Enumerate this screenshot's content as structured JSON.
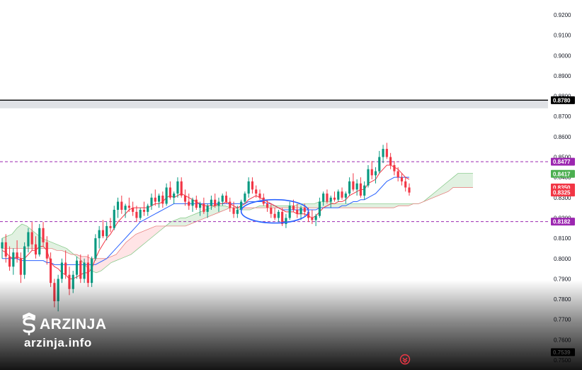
{
  "watermark": {
    "name": "ARZINJA",
    "site": "arzinja.info"
  },
  "chart_data": {
    "type": "candlestick",
    "y_axis": {
      "range": [
        0.75,
        0.925
      ],
      "ticks": [
        "0.9200",
        "0.9100",
        "0.9000",
        "0.8900",
        "0.8800",
        "0.8700",
        "0.8600",
        "0.8500",
        "0.8400",
        "0.8300",
        "0.8200",
        "0.8100",
        "0.8000",
        "0.7900",
        "0.7800",
        "0.7700",
        "0.7600",
        "0.7539",
        "0.7500"
      ]
    },
    "horizontal_line": {
      "value": 0.878,
      "label": "0.8780",
      "band": [
        0.874,
        0.878
      ],
      "color": "#000000"
    },
    "dashed_levels": [
      {
        "value": 0.8477,
        "label": "0.8477",
        "color": "#9c27b0"
      },
      {
        "value": 0.8182,
        "label": "0.8182",
        "color": "#9c27b0"
      }
    ],
    "price_tags": [
      {
        "value": 0.8417,
        "label": "0.8417",
        "color": "#4caf50"
      },
      {
        "value": 0.835,
        "label": "0.8350",
        "color": "#f23645"
      },
      {
        "value": 0.8325,
        "label": "0.8325",
        "color": "#f23645"
      },
      {
        "value": 0.7539,
        "label": "0.7539",
        "color": "#000000"
      }
    ],
    "colors": {
      "up": "#089981",
      "down": "#f23645",
      "tenkan": "#f23645",
      "kijun": "#2962ff",
      "cloud_up": "#c8e6c9",
      "cloud_down": "#ffcdd2",
      "ellipse": "#2962ff"
    },
    "candles": [
      [
        0.805,
        0.81,
        0.8,
        0.808
      ],
      [
        0.808,
        0.812,
        0.798,
        0.801
      ],
      [
        0.801,
        0.806,
        0.794,
        0.796
      ],
      [
        0.796,
        0.805,
        0.792,
        0.803
      ],
      [
        0.803,
        0.809,
        0.798,
        0.8
      ],
      [
        0.8,
        0.803,
        0.788,
        0.792
      ],
      [
        0.792,
        0.808,
        0.79,
        0.806
      ],
      [
        0.806,
        0.815,
        0.803,
        0.813
      ],
      [
        0.813,
        0.818,
        0.804,
        0.807
      ],
      [
        0.807,
        0.811,
        0.8,
        0.802
      ],
      [
        0.802,
        0.817,
        0.801,
        0.815
      ],
      [
        0.815,
        0.818,
        0.806,
        0.808
      ],
      [
        0.808,
        0.811,
        0.797,
        0.8
      ],
      [
        0.8,
        0.803,
        0.786,
        0.788
      ],
      [
        0.788,
        0.79,
        0.776,
        0.779
      ],
      [
        0.779,
        0.792,
        0.774,
        0.79
      ],
      [
        0.79,
        0.8,
        0.788,
        0.798
      ],
      [
        0.798,
        0.804,
        0.79,
        0.792
      ],
      [
        0.792,
        0.796,
        0.782,
        0.785
      ],
      [
        0.785,
        0.794,
        0.783,
        0.792
      ],
      [
        0.792,
        0.801,
        0.79,
        0.799
      ],
      [
        0.799,
        0.802,
        0.788,
        0.79
      ],
      [
        0.79,
        0.8,
        0.788,
        0.798
      ],
      [
        0.798,
        0.802,
        0.786,
        0.788
      ],
      [
        0.788,
        0.801,
        0.786,
        0.8
      ],
      [
        0.8,
        0.812,
        0.799,
        0.81
      ],
      [
        0.81,
        0.816,
        0.805,
        0.814
      ],
      [
        0.814,
        0.819,
        0.81,
        0.811
      ],
      [
        0.811,
        0.818,
        0.809,
        0.816
      ],
      [
        0.816,
        0.82,
        0.813,
        0.815
      ],
      [
        0.815,
        0.826,
        0.814,
        0.824
      ],
      [
        0.824,
        0.83,
        0.82,
        0.828
      ],
      [
        0.828,
        0.831,
        0.822,
        0.824
      ],
      [
        0.824,
        0.827,
        0.82,
        0.826
      ],
      [
        0.826,
        0.83,
        0.823,
        0.825
      ],
      [
        0.825,
        0.828,
        0.821,
        0.823
      ],
      [
        0.823,
        0.826,
        0.818,
        0.82
      ],
      [
        0.82,
        0.825,
        0.819,
        0.824
      ],
      [
        0.824,
        0.828,
        0.821,
        0.823
      ],
      [
        0.823,
        0.827,
        0.821,
        0.826
      ],
      [
        0.826,
        0.832,
        0.824,
        0.83
      ],
      [
        0.83,
        0.834,
        0.826,
        0.828
      ],
      [
        0.828,
        0.832,
        0.825,
        0.831
      ],
      [
        0.831,
        0.833,
        0.825,
        0.827
      ],
      [
        0.827,
        0.837,
        0.826,
        0.835
      ],
      [
        0.835,
        0.838,
        0.829,
        0.83
      ],
      [
        0.83,
        0.833,
        0.827,
        0.832
      ],
      [
        0.832,
        0.84,
        0.83,
        0.838
      ],
      [
        0.838,
        0.84,
        0.83,
        0.831
      ],
      [
        0.831,
        0.834,
        0.826,
        0.828
      ],
      [
        0.828,
        0.832,
        0.824,
        0.826
      ],
      [
        0.826,
        0.83,
        0.823,
        0.829
      ],
      [
        0.829,
        0.831,
        0.824,
        0.825
      ],
      [
        0.825,
        0.828,
        0.821,
        0.827
      ],
      [
        0.827,
        0.83,
        0.822,
        0.823
      ],
      [
        0.823,
        0.827,
        0.82,
        0.826
      ],
      [
        0.826,
        0.831,
        0.824,
        0.829
      ],
      [
        0.829,
        0.832,
        0.825,
        0.826
      ],
      [
        0.826,
        0.83,
        0.823,
        0.828
      ],
      [
        0.828,
        0.832,
        0.826,
        0.831
      ],
      [
        0.831,
        0.833,
        0.827,
        0.828
      ],
      [
        0.828,
        0.83,
        0.823,
        0.825
      ],
      [
        0.825,
        0.828,
        0.82,
        0.822
      ],
      [
        0.822,
        0.826,
        0.82,
        0.824
      ],
      [
        0.824,
        0.829,
        0.823,
        0.828
      ],
      [
        0.828,
        0.833,
        0.827,
        0.832
      ],
      [
        0.832,
        0.84,
        0.83,
        0.838
      ],
      [
        0.838,
        0.84,
        0.832,
        0.834
      ],
      [
        0.834,
        0.836,
        0.83,
        0.832
      ],
      [
        0.832,
        0.834,
        0.829,
        0.83
      ],
      [
        0.83,
        0.832,
        0.826,
        0.827
      ],
      [
        0.827,
        0.829,
        0.823,
        0.825
      ],
      [
        0.825,
        0.827,
        0.82,
        0.822
      ],
      [
        0.822,
        0.825,
        0.819,
        0.82
      ],
      [
        0.82,
        0.824,
        0.818,
        0.823
      ],
      [
        0.823,
        0.825,
        0.816,
        0.817
      ],
      [
        0.817,
        0.822,
        0.815,
        0.82
      ],
      [
        0.82,
        0.828,
        0.819,
        0.826
      ],
      [
        0.826,
        0.829,
        0.823,
        0.824
      ],
      [
        0.824,
        0.827,
        0.82,
        0.822
      ],
      [
        0.822,
        0.826,
        0.819,
        0.825
      ],
      [
        0.825,
        0.827,
        0.821,
        0.823
      ],
      [
        0.823,
        0.825,
        0.818,
        0.82
      ],
      [
        0.82,
        0.824,
        0.817,
        0.819
      ],
      [
        0.819,
        0.822,
        0.816,
        0.821
      ],
      [
        0.821,
        0.83,
        0.82,
        0.828
      ],
      [
        0.828,
        0.833,
        0.826,
        0.832
      ],
      [
        0.832,
        0.834,
        0.827,
        0.828
      ],
      [
        0.828,
        0.831,
        0.825,
        0.83
      ],
      [
        0.83,
        0.833,
        0.828,
        0.829
      ],
      [
        0.829,
        0.834,
        0.828,
        0.833
      ],
      [
        0.833,
        0.835,
        0.829,
        0.83
      ],
      [
        0.83,
        0.833,
        0.827,
        0.832
      ],
      [
        0.832,
        0.84,
        0.831,
        0.838
      ],
      [
        0.838,
        0.842,
        0.833,
        0.834
      ],
      [
        0.834,
        0.839,
        0.831,
        0.837
      ],
      [
        0.837,
        0.84,
        0.83,
        0.831
      ],
      [
        0.831,
        0.838,
        0.829,
        0.836
      ],
      [
        0.836,
        0.846,
        0.835,
        0.844
      ],
      [
        0.844,
        0.848,
        0.839,
        0.841
      ],
      [
        0.841,
        0.845,
        0.837,
        0.843
      ],
      [
        0.843,
        0.853,
        0.842,
        0.85
      ],
      [
        0.85,
        0.856,
        0.847,
        0.854
      ],
      [
        0.854,
        0.857,
        0.849,
        0.85
      ],
      [
        0.85,
        0.852,
        0.844,
        0.846
      ],
      [
        0.846,
        0.848,
        0.841,
        0.843
      ],
      [
        0.843,
        0.845,
        0.838,
        0.84
      ],
      [
        0.84,
        0.842,
        0.836,
        0.838
      ],
      [
        0.838,
        0.84,
        0.833,
        0.835
      ],
      [
        0.835,
        0.837,
        0.831,
        0.8325
      ]
    ],
    "tenkan": [
      0.804,
      0.803,
      0.801,
      0.8,
      0.801,
      0.8,
      0.8,
      0.802,
      0.804,
      0.804,
      0.806,
      0.806,
      0.804,
      0.798,
      0.796,
      0.795,
      0.793,
      0.792,
      0.79,
      0.79,
      0.791,
      0.792,
      0.793,
      0.793,
      0.795,
      0.8,
      0.804,
      0.807,
      0.81,
      0.812,
      0.815,
      0.818,
      0.82,
      0.822,
      0.824,
      0.825,
      0.825,
      0.825,
      0.825,
      0.825,
      0.826,
      0.827,
      0.827,
      0.828,
      0.83,
      0.831,
      0.83,
      0.831,
      0.832,
      0.831,
      0.83,
      0.829,
      0.828,
      0.827,
      0.826,
      0.826,
      0.826,
      0.826,
      0.827,
      0.827,
      0.828,
      0.827,
      0.826,
      0.825,
      0.826,
      0.827,
      0.829,
      0.83,
      0.831,
      0.83,
      0.829,
      0.828,
      0.827,
      0.826,
      0.825,
      0.824,
      0.823,
      0.823,
      0.823,
      0.822,
      0.822,
      0.822,
      0.821,
      0.82,
      0.821,
      0.823,
      0.825,
      0.826,
      0.827,
      0.827,
      0.828,
      0.828,
      0.829,
      0.831,
      0.832,
      0.833,
      0.834,
      0.834,
      0.837,
      0.838,
      0.839,
      0.842,
      0.844,
      0.846,
      0.846,
      0.845,
      0.844,
      0.842,
      0.84,
      0.839
    ],
    "kijun": [
      0.8,
      0.8,
      0.8,
      0.8,
      0.8,
      0.799,
      0.799,
      0.799,
      0.799,
      0.799,
      0.799,
      0.799,
      0.798,
      0.798,
      0.797,
      0.797,
      0.797,
      0.797,
      0.797,
      0.797,
      0.797,
      0.797,
      0.797,
      0.797,
      0.797,
      0.797,
      0.798,
      0.799,
      0.8,
      0.802,
      0.804,
      0.806,
      0.808,
      0.81,
      0.812,
      0.814,
      0.816,
      0.818,
      0.819,
      0.82,
      0.821,
      0.822,
      0.823,
      0.824,
      0.825,
      0.826,
      0.827,
      0.827,
      0.827,
      0.827,
      0.827,
      0.827,
      0.827,
      0.827,
      0.827,
      0.827,
      0.827,
      0.827,
      0.827,
      0.827,
      0.827,
      0.827,
      0.827,
      0.827,
      0.827,
      0.827,
      0.828,
      0.828,
      0.828,
      0.828,
      0.828,
      0.827,
      0.827,
      0.826,
      0.825,
      0.824,
      0.824,
      0.824,
      0.824,
      0.824,
      0.824,
      0.824,
      0.824,
      0.824,
      0.824,
      0.825,
      0.825,
      0.825,
      0.825,
      0.825,
      0.825,
      0.826,
      0.826,
      0.827,
      0.828,
      0.828,
      0.829,
      0.829,
      0.83,
      0.831,
      0.832,
      0.834,
      0.836,
      0.838,
      0.839,
      0.84,
      0.84,
      0.84,
      0.84,
      0.84
    ],
    "cloud": {
      "span_a": [
        0.81,
        0.811,
        0.812,
        0.815,
        0.817,
        0.816,
        0.814,
        0.812,
        0.81,
        0.809,
        0.808,
        0.807,
        0.806,
        0.805,
        0.803,
        0.801,
        0.799,
        0.796,
        0.794,
        0.793,
        0.794,
        0.796,
        0.798,
        0.799,
        0.8,
        0.801,
        0.802,
        0.804,
        0.806,
        0.808,
        0.81,
        0.812,
        0.814,
        0.816,
        0.818,
        0.819,
        0.82,
        0.82,
        0.821,
        0.822,
        0.823,
        0.824,
        0.825,
        0.826,
        0.826,
        0.826,
        0.825,
        0.825,
        0.824,
        0.824,
        0.824,
        0.825,
        0.826,
        0.826,
        0.826,
        0.826,
        0.826,
        0.826,
        0.826,
        0.826,
        0.827,
        0.827,
        0.827,
        0.827,
        0.828,
        0.828,
        0.828,
        0.827,
        0.827,
        0.827,
        0.827,
        0.827,
        0.827,
        0.827,
        0.827,
        0.827,
        0.827,
        0.827,
        0.827,
        0.827,
        0.827,
        0.827,
        0.827,
        0.827,
        0.827,
        0.828,
        0.83,
        0.832,
        0.834,
        0.836,
        0.838,
        0.84,
        0.842,
        0.842,
        0.842,
        0.842
      ],
      "span_b": [
        0.805,
        0.805,
        0.805,
        0.805,
        0.805,
        0.805,
        0.805,
        0.805,
        0.805,
        0.805,
        0.805,
        0.804,
        0.804,
        0.803,
        0.802,
        0.802,
        0.801,
        0.801,
        0.8,
        0.8,
        0.8,
        0.8,
        0.801,
        0.802,
        0.805,
        0.808,
        0.81,
        0.812,
        0.813,
        0.814,
        0.815,
        0.816,
        0.816,
        0.816,
        0.816,
        0.816,
        0.816,
        0.816,
        0.817,
        0.818,
        0.819,
        0.82,
        0.821,
        0.822,
        0.823,
        0.824,
        0.825,
        0.825,
        0.825,
        0.825,
        0.825,
        0.825,
        0.825,
        0.825,
        0.825,
        0.825,
        0.825,
        0.825,
        0.825,
        0.825,
        0.825,
        0.825,
        0.825,
        0.825,
        0.825,
        0.825,
        0.825,
        0.825,
        0.825,
        0.825,
        0.825,
        0.825,
        0.825,
        0.825,
        0.825,
        0.825,
        0.825,
        0.825,
        0.825,
        0.825,
        0.826,
        0.826,
        0.826,
        0.827,
        0.827,
        0.828,
        0.829,
        0.83,
        0.831,
        0.832,
        0.833,
        0.835,
        0.835,
        0.835,
        0.835,
        0.835
      ]
    },
    "ellipse": {
      "start_index": 64,
      "end_index": 82,
      "top": 0.829,
      "bottom": 0.8175
    }
  }
}
